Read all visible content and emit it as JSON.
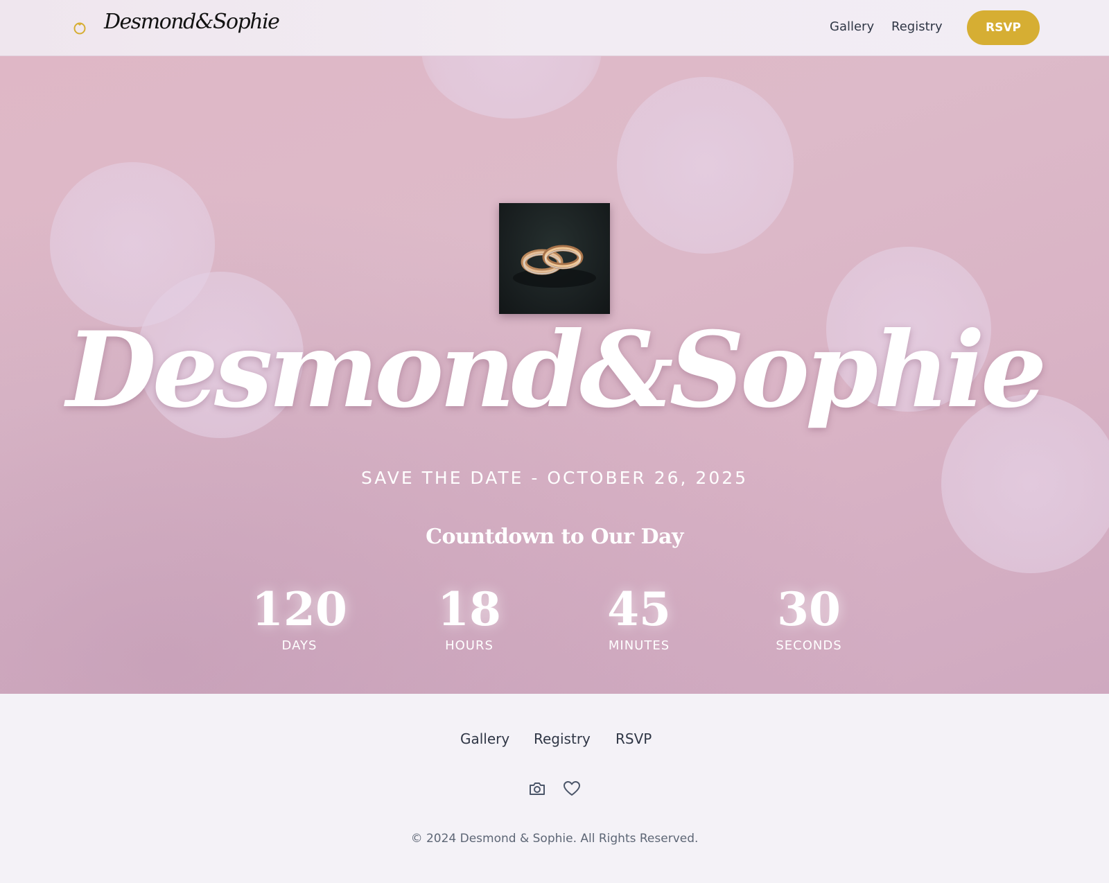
{
  "header": {
    "brand": "Desmond&Sophie",
    "nav": {
      "gallery": "Gallery",
      "registry": "Registry"
    },
    "rsvp_label": "RSVP"
  },
  "hero": {
    "title": "Desmond&Sophie",
    "save_the_date": "SAVE THE DATE - OCTOBER 26, 2025",
    "countdown_heading": "Countdown to Our Day",
    "countdown": {
      "days": {
        "value": "120",
        "label": "DAYS"
      },
      "hours": {
        "value": "18",
        "label": "HOURS"
      },
      "minutes": {
        "value": "45",
        "label": "MINUTES"
      },
      "seconds": {
        "value": "30",
        "label": "SECONDS"
      }
    }
  },
  "footer": {
    "links": {
      "gallery": "Gallery",
      "registry": "Registry",
      "rsvp": "RSVP"
    },
    "icons": [
      "camera-icon",
      "heart-icon"
    ],
    "copyright": "© 2024 Desmond & Sophie. All Rights Reserved."
  },
  "colors": {
    "accent": "#d6ae33",
    "text": "#2f3645",
    "hero_pink": "#ddbac9",
    "footer_bg": "#f4f2f7"
  }
}
